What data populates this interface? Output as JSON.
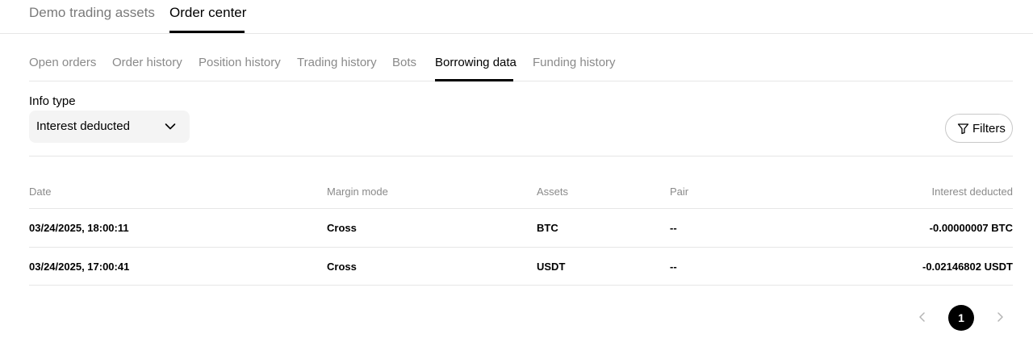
{
  "top_tabs": [
    {
      "label": "Demo trading assets"
    },
    {
      "label": "Order center"
    }
  ],
  "sub_tabs": [
    {
      "label": "Open orders"
    },
    {
      "label": "Order history"
    },
    {
      "label": "Position history"
    },
    {
      "label": "Trading history"
    },
    {
      "label": "Bots"
    },
    {
      "label": "Borrowing data"
    },
    {
      "label": "Funding history"
    }
  ],
  "info_type": {
    "label": "Info type",
    "selected": "Interest deducted"
  },
  "filters": {
    "label": "Filters"
  },
  "table": {
    "headers": [
      "Date",
      "Margin mode",
      "Assets",
      "Pair",
      "Interest deducted"
    ],
    "rows": [
      [
        "03/24/2025, 18:00:11",
        "Cross",
        "BTC",
        "--",
        "-0.00000007 BTC"
      ],
      [
        "03/24/2025, 17:00:41",
        "Cross",
        "USDT",
        "--",
        "-0.02146802 USDT"
      ]
    ]
  },
  "pagination": {
    "current_page": "1"
  },
  "icons": {
    "select": "chevron-down-icon",
    "filters": "filter-icon",
    "prev": "chevron-left-icon",
    "next": "chevron-right-icon"
  }
}
